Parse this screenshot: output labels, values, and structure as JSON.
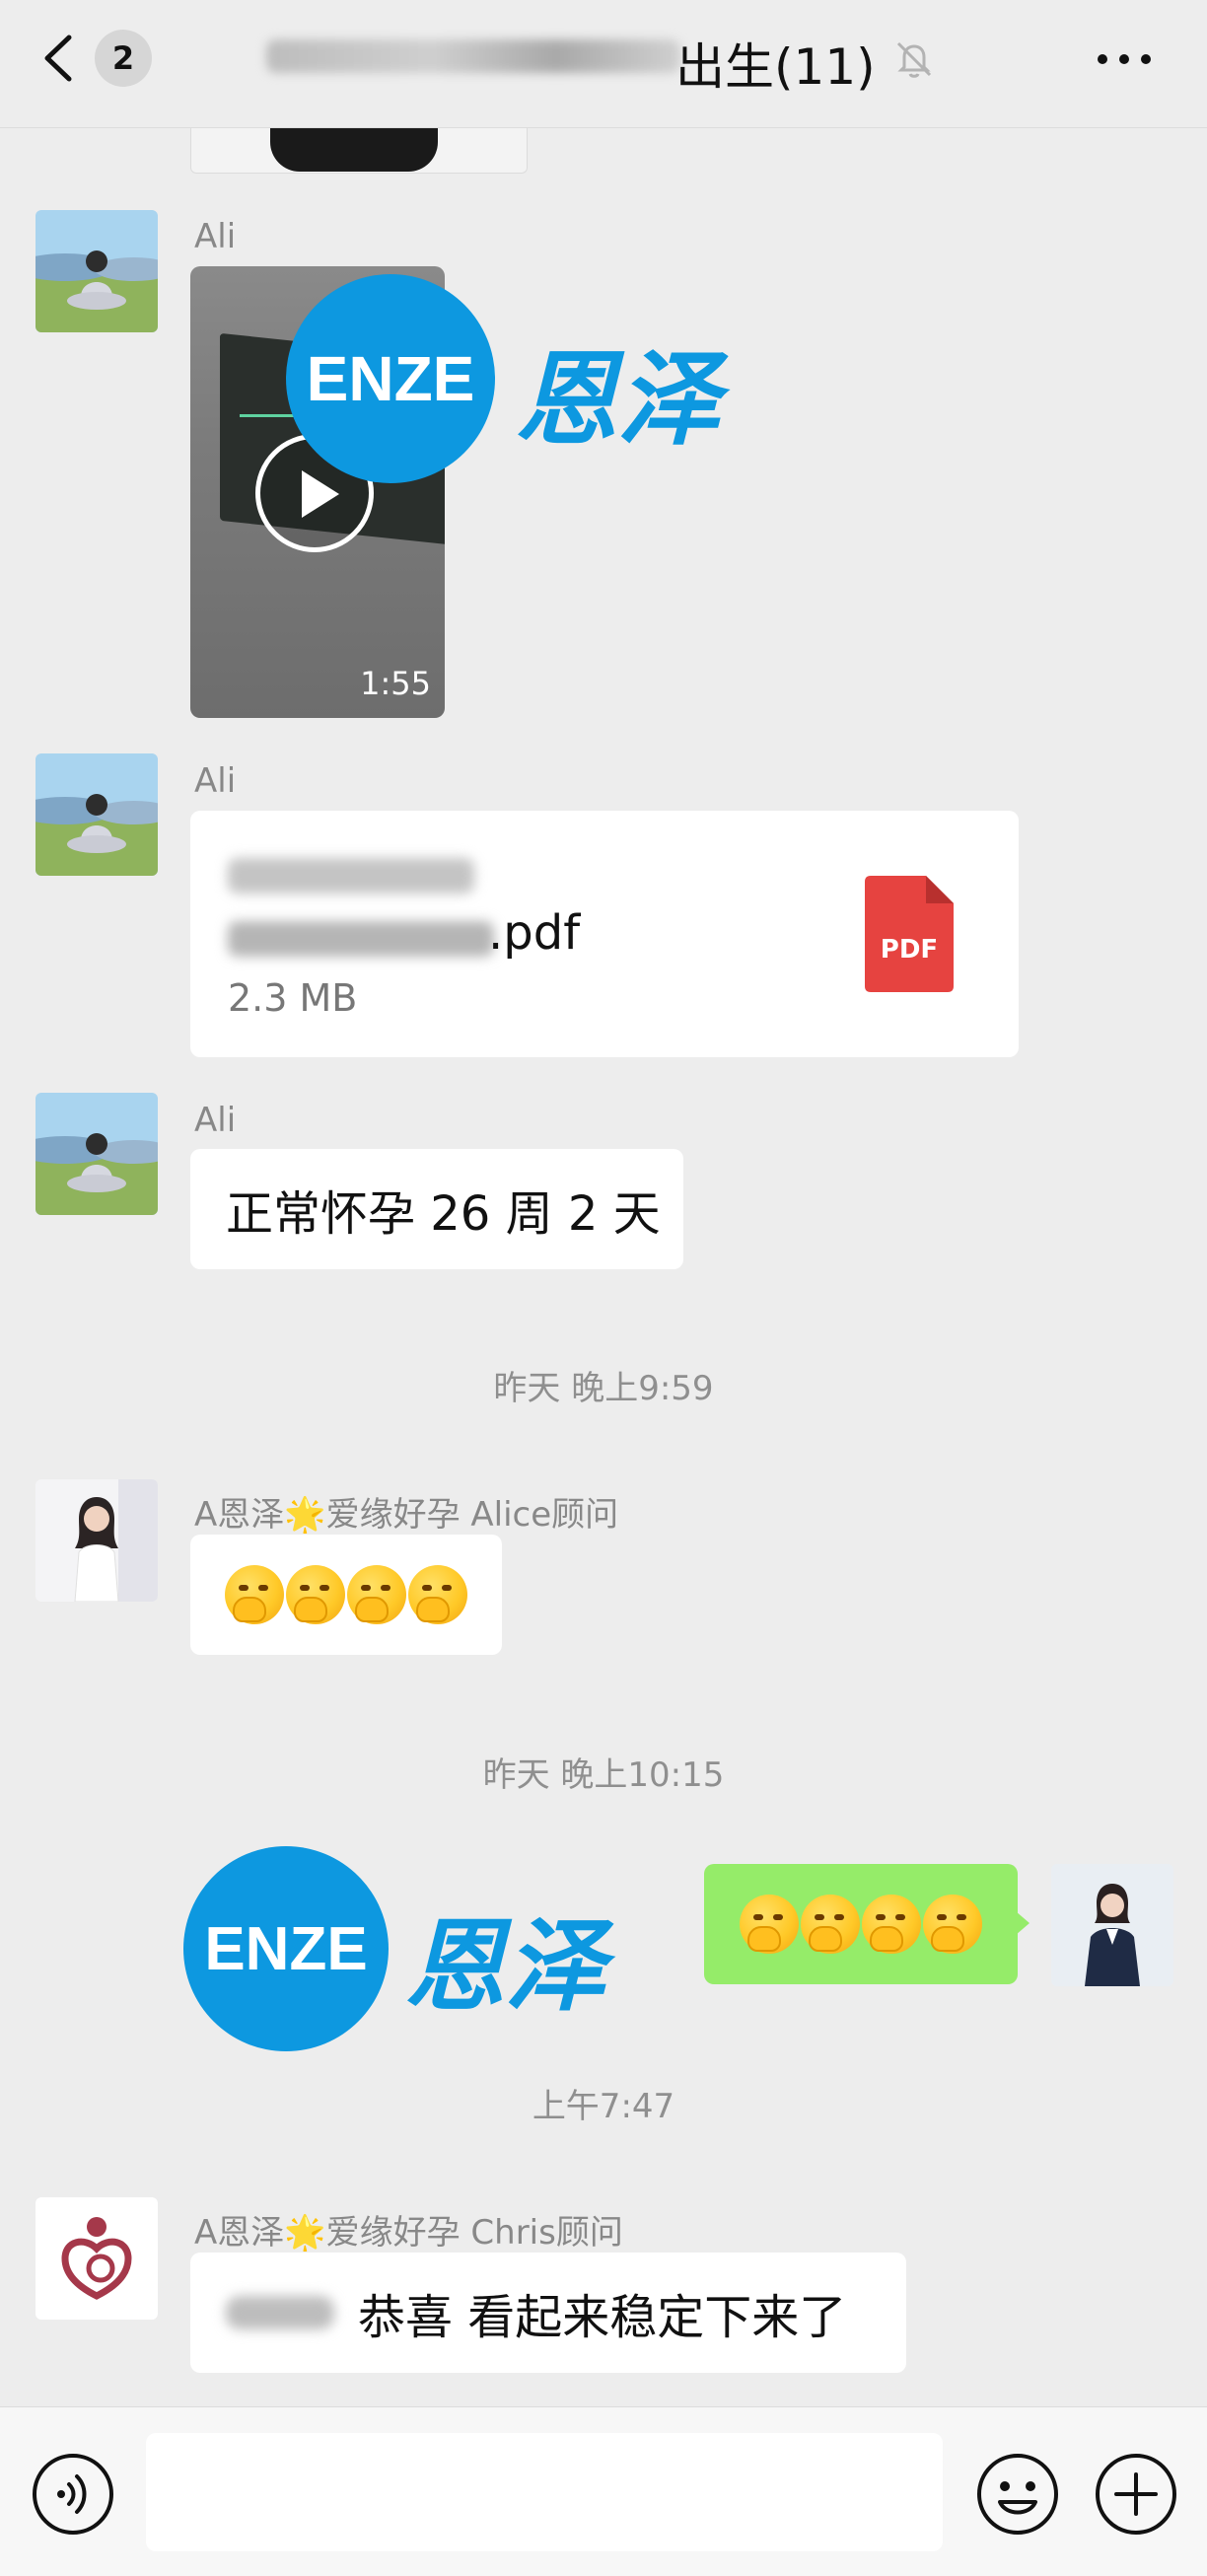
{
  "header": {
    "unread_count": "2",
    "title_suffix": "出生(11)",
    "back_icon": "chevron-left-icon",
    "mute_icon": "bell-off-icon",
    "more_icon": "ellipsis-icon"
  },
  "watermark": {
    "logo_text": "ENZE",
    "brand_text": "恩泽",
    "color": "#0d98e0"
  },
  "messages": [
    {
      "sender": "Ali",
      "type": "video",
      "duration": "1:55"
    },
    {
      "sender": "Ali",
      "type": "file",
      "file_ext": ".pdf",
      "file_size": "2.3 MB",
      "file_icon_label": "PDF"
    },
    {
      "sender": "Ali",
      "type": "text",
      "text": "正常怀孕 26 周 2 天"
    },
    {
      "type": "time",
      "text": "昨天 晚上9:59"
    },
    {
      "sender": "A恩泽🌟爱缘好孕 Alice顾问",
      "type": "emoji",
      "count": 4
    },
    {
      "type": "time",
      "text": "昨天 晚上10:15"
    },
    {
      "sender": "me",
      "type": "emoji",
      "count": 4
    },
    {
      "type": "time",
      "text": "上午7:47"
    },
    {
      "sender": "A恩泽🌟爱缘好孕 Chris顾问",
      "type": "text",
      "text": "恭喜 看起来稳定下来了"
    }
  ],
  "input": {
    "value": "",
    "placeholder": ""
  },
  "toolbar": {
    "voice_icon": "voice-icon",
    "emoji_icon": "smiley-icon",
    "plus_icon": "plus-circle-icon"
  },
  "colors": {
    "background": "#ededed",
    "my_bubble": "#95ec69",
    "pdf_red": "#e64340"
  }
}
